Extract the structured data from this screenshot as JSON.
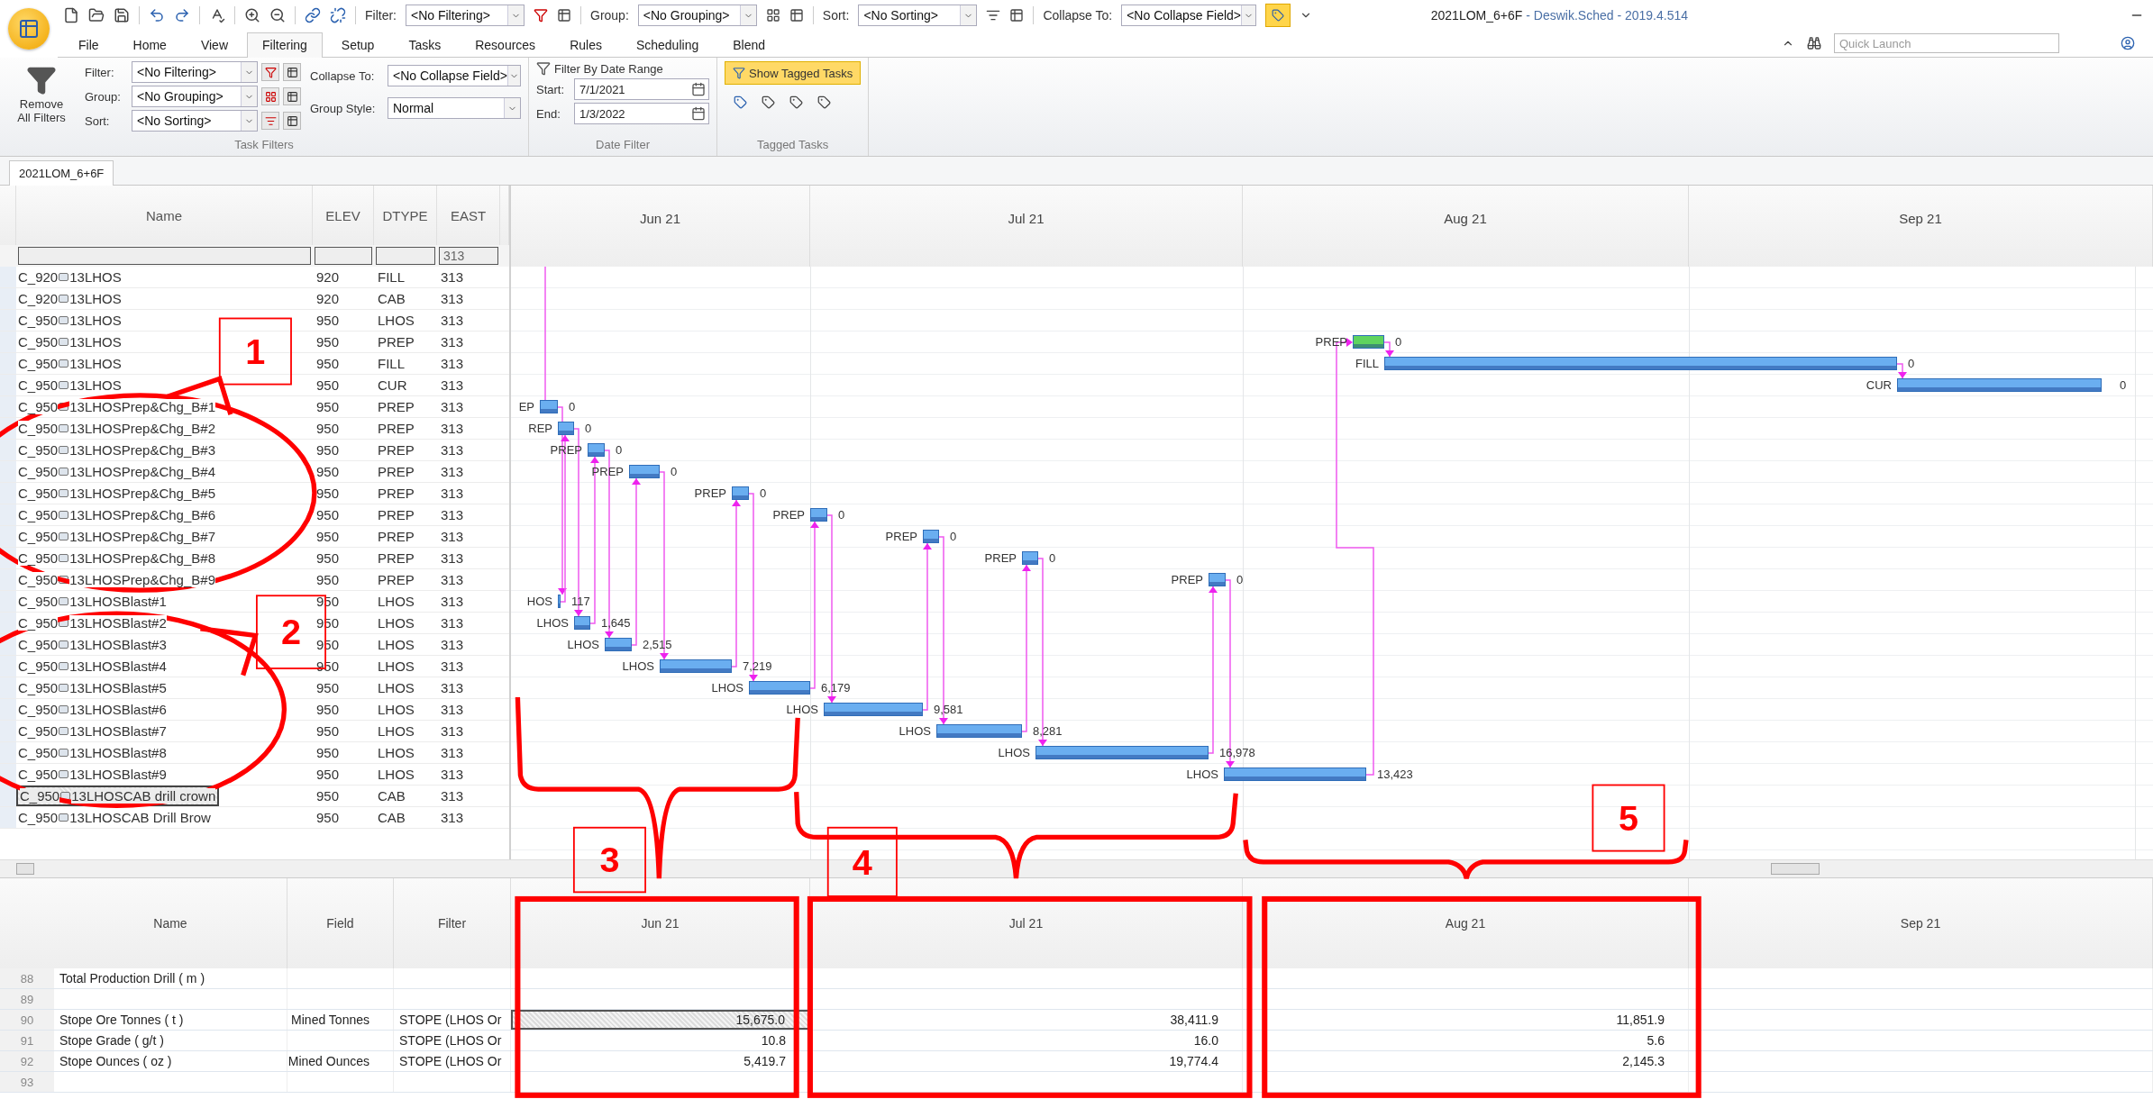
{
  "quick_access": {
    "filter_label": "Filter:",
    "filter_value": "<No Filtering>",
    "group_label": "Group:",
    "group_value": "<No Grouping>",
    "sort_label": "Sort:",
    "sort_value": "<No Sorting>",
    "collapse_label": "Collapse To:",
    "collapse_value": "<No Collapse Field>",
    "toggle_on": true
  },
  "window": {
    "title": "2021LOM_6+6F",
    "app": " - Deswik.Sched - 2019.4.514"
  },
  "menu_tabs": [
    {
      "label": "File",
      "selected": false
    },
    {
      "label": "Home",
      "selected": false
    },
    {
      "label": "View",
      "selected": false
    },
    {
      "label": "Filtering",
      "selected": true
    },
    {
      "label": "Setup",
      "selected": false
    },
    {
      "label": "Tasks",
      "selected": false
    },
    {
      "label": "Resources",
      "selected": false
    },
    {
      "label": "Rules",
      "selected": false
    },
    {
      "label": "Scheduling",
      "selected": false
    },
    {
      "label": "Blend",
      "selected": false
    }
  ],
  "quick_launch": {
    "placeholder": "Quick Launch"
  },
  "ribbon": {
    "remove_filters": "Remove All Filters",
    "filters": [
      {
        "label": "Filter:",
        "value": "<No Filtering>"
      },
      {
        "label": "Group:",
        "value": "<No Grouping>"
      },
      {
        "label": "Sort:",
        "value": "<No Sorting>"
      }
    ],
    "collapse": {
      "label": "Collapse To:",
      "value": "<No Collapse Field>"
    },
    "group_style": {
      "label": "Group Style:",
      "value": "Normal"
    },
    "task_filters_caption": "Task Filters",
    "date_filter": {
      "heading": "Filter By Date Range",
      "start_label": "Start:",
      "start": "7/1/2021",
      "end_label": "End:",
      "end": "1/3/2022",
      "caption": "Date Filter"
    },
    "tagged": {
      "button": "Show Tagged Tasks",
      "on": true,
      "caption": "Tagged Tasks"
    }
  },
  "document_tab": {
    "label": "2021LOM_6+6F"
  },
  "task_grid": {
    "columns": [
      "Name",
      "ELEV",
      "DTYPE",
      "EAST"
    ],
    "east_filter": "313"
  },
  "tasks": [
    {
      "prefix": "C_920",
      "suffix": "13LHOS",
      "elev": "920",
      "dtype": "FILL",
      "east": "313",
      "selected": false
    },
    {
      "prefix": "C_920",
      "suffix": "13LHOS",
      "elev": "920",
      "dtype": "CAB",
      "east": "313",
      "selected": false
    },
    {
      "prefix": "C_950",
      "suffix": "13LHOS",
      "elev": "950",
      "dtype": "LHOS",
      "east": "313",
      "selected": false
    },
    {
      "prefix": "C_950",
      "suffix": "13LHOS",
      "elev": "950",
      "dtype": "PREP",
      "east": "313",
      "selected": false,
      "bar": {
        "label": "PREP",
        "value": "0",
        "color": "#5fd35f"
      }
    },
    {
      "prefix": "C_950",
      "suffix": "13LHOS",
      "elev": "950",
      "dtype": "FILL",
      "east": "313",
      "selected": false,
      "bar": {
        "label": "FILL",
        "value": "0",
        "color": "#6aaef0"
      }
    },
    {
      "prefix": "C_950",
      "suffix": "13LHOS",
      "elev": "950",
      "dtype": "CUR",
      "east": "313",
      "selected": false,
      "bar": {
        "label": "CUR",
        "value": "0",
        "color": "#6aaef0"
      }
    },
    {
      "prefix": "C_950",
      "suffix": "13LHOSPrep&Chg_B#1",
      "elev": "950",
      "dtype": "PREP",
      "east": "313",
      "selected": false,
      "bar": {
        "label": "EP",
        "value": "0",
        "color": "#6aaef0"
      }
    },
    {
      "prefix": "C_950",
      "suffix": "13LHOSPrep&Chg_B#2",
      "elev": "950",
      "dtype": "PREP",
      "east": "313",
      "selected": false,
      "bar": {
        "label": "REP",
        "value": "0",
        "color": "#6aaef0"
      }
    },
    {
      "prefix": "C_950",
      "suffix": "13LHOSPrep&Chg_B#3",
      "elev": "950",
      "dtype": "PREP",
      "east": "313",
      "selected": false,
      "bar": {
        "label": "PREP",
        "value": "0",
        "color": "#6aaef0"
      }
    },
    {
      "prefix": "C_950",
      "suffix": "13LHOSPrep&Chg_B#4",
      "elev": "950",
      "dtype": "PREP",
      "east": "313",
      "selected": false,
      "bar": {
        "label": "PREP",
        "value": "0",
        "color": "#6aaef0"
      }
    },
    {
      "prefix": "C_950",
      "suffix": "13LHOSPrep&Chg_B#5",
      "elev": "950",
      "dtype": "PREP",
      "east": "313",
      "selected": false,
      "bar": {
        "label": "PREP",
        "value": "0",
        "color": "#6aaef0"
      }
    },
    {
      "prefix": "C_950",
      "suffix": "13LHOSPrep&Chg_B#6",
      "elev": "950",
      "dtype": "PREP",
      "east": "313",
      "selected": false,
      "bar": {
        "label": "PREP",
        "value": "0",
        "color": "#6aaef0"
      }
    },
    {
      "prefix": "C_950",
      "suffix": "13LHOSPrep&Chg_B#7",
      "elev": "950",
      "dtype": "PREP",
      "east": "313",
      "selected": false,
      "bar": {
        "label": "PREP",
        "value": "0",
        "color": "#6aaef0"
      }
    },
    {
      "prefix": "C_950",
      "suffix": "13LHOSPrep&Chg_B#8",
      "elev": "950",
      "dtype": "PREP",
      "east": "313",
      "selected": false,
      "bar": {
        "label": "PREP",
        "value": "0",
        "color": "#6aaef0"
      }
    },
    {
      "prefix": "C_950",
      "suffix": "13LHOSPrep&Chg_B#9",
      "elev": "950",
      "dtype": "PREP",
      "east": "313",
      "selected": false,
      "bar": {
        "label": "PREP",
        "value": "0",
        "color": "#6aaef0"
      }
    },
    {
      "prefix": "C_950",
      "suffix": "13LHOSBlast#1",
      "elev": "950",
      "dtype": "LHOS",
      "east": "313",
      "selected": false,
      "bar": {
        "label": "HOS",
        "value": "117",
        "color": "#6aaef0"
      }
    },
    {
      "prefix": "C_950",
      "suffix": "13LHOSBlast#2",
      "elev": "950",
      "dtype": "LHOS",
      "east": "313",
      "selected": false,
      "bar": {
        "label": "LHOS",
        "value": "1,645",
        "color": "#6aaef0"
      }
    },
    {
      "prefix": "C_950",
      "suffix": "13LHOSBlast#3",
      "elev": "950",
      "dtype": "LHOS",
      "east": "313",
      "selected": false,
      "bar": {
        "label": "LHOS",
        "value": "2,515",
        "color": "#6aaef0"
      }
    },
    {
      "prefix": "C_950",
      "suffix": "13LHOSBlast#4",
      "elev": "950",
      "dtype": "LHOS",
      "east": "313",
      "selected": false,
      "bar": {
        "label": "LHOS",
        "value": "7,219",
        "color": "#6aaef0"
      }
    },
    {
      "prefix": "C_950",
      "suffix": "13LHOSBlast#5",
      "elev": "950",
      "dtype": "LHOS",
      "east": "313",
      "selected": false,
      "bar": {
        "label": "LHOS",
        "value": "6,179",
        "color": "#6aaef0"
      }
    },
    {
      "prefix": "C_950",
      "suffix": "13LHOSBlast#6",
      "elev": "950",
      "dtype": "LHOS",
      "east": "313",
      "selected": false,
      "bar": {
        "label": "LHOS",
        "value": "9,581",
        "color": "#6aaef0"
      }
    },
    {
      "prefix": "C_950",
      "suffix": "13LHOSBlast#7",
      "elev": "950",
      "dtype": "LHOS",
      "east": "313",
      "selected": false,
      "bar": {
        "label": "LHOS",
        "value": "8,281",
        "color": "#6aaef0"
      }
    },
    {
      "prefix": "C_950",
      "suffix": "13LHOSBlast#8",
      "elev": "950",
      "dtype": "LHOS",
      "east": "313",
      "selected": false,
      "bar": {
        "label": "LHOS",
        "value": "16,978",
        "color": "#6aaef0"
      }
    },
    {
      "prefix": "C_950",
      "suffix": "13LHOSBlast#9",
      "elev": "950",
      "dtype": "LHOS",
      "east": "313",
      "selected": false,
      "bar": {
        "label": "LHOS",
        "value": "13,423",
        "color": "#6aaef0"
      }
    },
    {
      "prefix": "C_950",
      "suffix": "13LHOSCAB drill crown",
      "elev": "950",
      "dtype": "CAB",
      "east": "313",
      "selected": true
    },
    {
      "prefix": "C_950",
      "suffix": "13LHOSCAB Drill Brow",
      "elev": "950",
      "dtype": "CAB",
      "east": "313",
      "selected": false
    }
  ],
  "timescale": [
    "Jun 21",
    "Jul 21",
    "Aug 21",
    "Sep 21"
  ],
  "report": {
    "columns": [
      "Name",
      "Field",
      "Filter"
    ],
    "months": [
      "Jun 21",
      "Jul 21",
      "Aug 21",
      "Sep 21"
    ],
    "rows": [
      {
        "number": "88",
        "name": "Total Production Drill ( m )"
      },
      {
        "number": "89"
      },
      {
        "number": "90",
        "name": "Stope Ore Tonnes ( t )",
        "field": "Mined Tonnes",
        "filter": "STOPE (LHOS Or",
        "values": [
          {
            "text": "15,675.0",
            "selected": true
          },
          {
            "text": "38,411.9",
            "selected": false
          },
          {
            "text": "11,851.9",
            "selected": false
          }
        ]
      },
      {
        "number": "91",
        "name": "Stope Grade ( g/t )",
        "filter": "STOPE (LHOS Or",
        "values": [
          {
            "text": "10.8",
            "selected": false
          },
          {
            "text": "16.0",
            "selected": false
          },
          {
            "text": "5.6",
            "selected": false
          }
        ]
      },
      {
        "number": "92",
        "name": "Stope Ounces ( oz )",
        "field": "Mined Ounces",
        "filter": "STOPE (LHOS Or",
        "values": [
          {
            "text": "5,419.7",
            "selected": false
          },
          {
            "text": "19,774.4",
            "selected": false
          },
          {
            "text": "2,145.3",
            "selected": false
          }
        ]
      },
      {
        "number": "93"
      }
    ]
  },
  "annotations": [
    {
      "label": "1"
    },
    {
      "label": "2"
    },
    {
      "label": "3"
    },
    {
      "label": "4"
    },
    {
      "label": "5"
    }
  ]
}
